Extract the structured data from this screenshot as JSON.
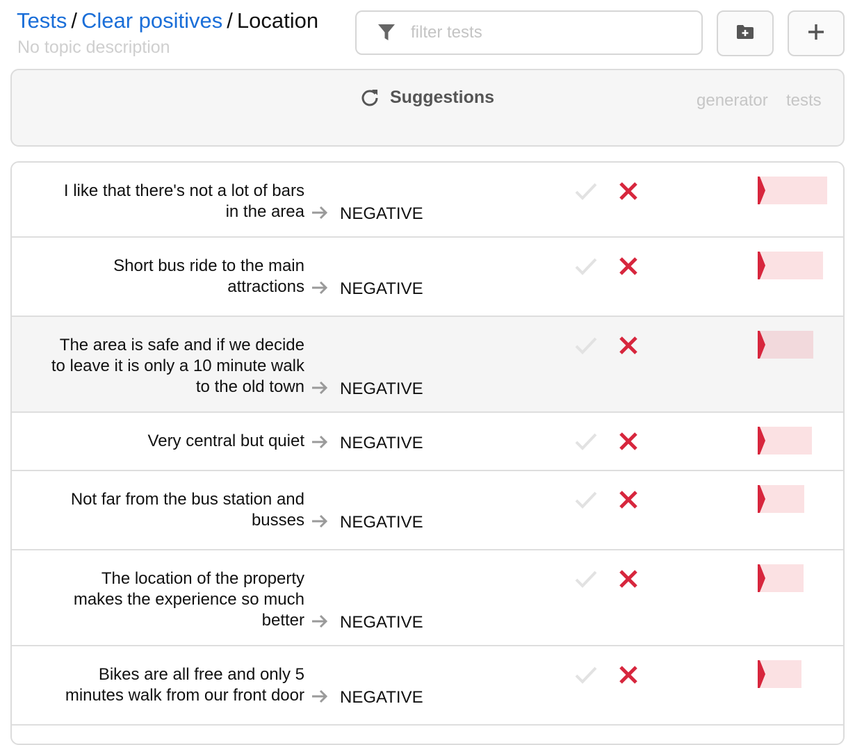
{
  "breadcrumb": {
    "root": "Tests",
    "sep1": "/",
    "parent": "Clear positives",
    "sep2": "/",
    "current": "Location"
  },
  "topic_description": "No topic description",
  "filter": {
    "placeholder": "filter tests"
  },
  "suggestions": {
    "title": "Suggestions",
    "col_generator": "generator",
    "col_tests": "tests"
  },
  "colors": {
    "link": "#1a6ed8",
    "fail_red": "#d7263d",
    "score_bar": "#fbe1e3",
    "check_gray": "#e2e2e2"
  },
  "tests": [
    {
      "lines": [
        "I like that there's not a lot of bars",
        "in the area"
      ],
      "label": "NEGATIVE",
      "score": 0.85
    },
    {
      "lines": [
        "Short bus ride to the main",
        "attractions"
      ],
      "label": "NEGATIVE",
      "score": 0.8
    },
    {
      "lines": [
        "The area is safe and if we decide",
        "to leave it is only a 10 minute walk",
        "to the old town"
      ],
      "label": "NEGATIVE",
      "score": 0.68
    },
    {
      "lines": [
        "Very central but quiet"
      ],
      "label": "NEGATIVE",
      "score": 0.66
    },
    {
      "lines": [
        "Not far from the bus station and",
        "busses"
      ],
      "label": "NEGATIVE",
      "score": 0.57
    },
    {
      "lines": [
        "The location of the property",
        "makes the experience so much",
        "better"
      ],
      "label": "NEGATIVE",
      "score": 0.56
    },
    {
      "lines": [
        "Bikes are all free and only 5",
        "minutes walk from our front door"
      ],
      "label": "NEGATIVE",
      "score": 0.53
    }
  ]
}
